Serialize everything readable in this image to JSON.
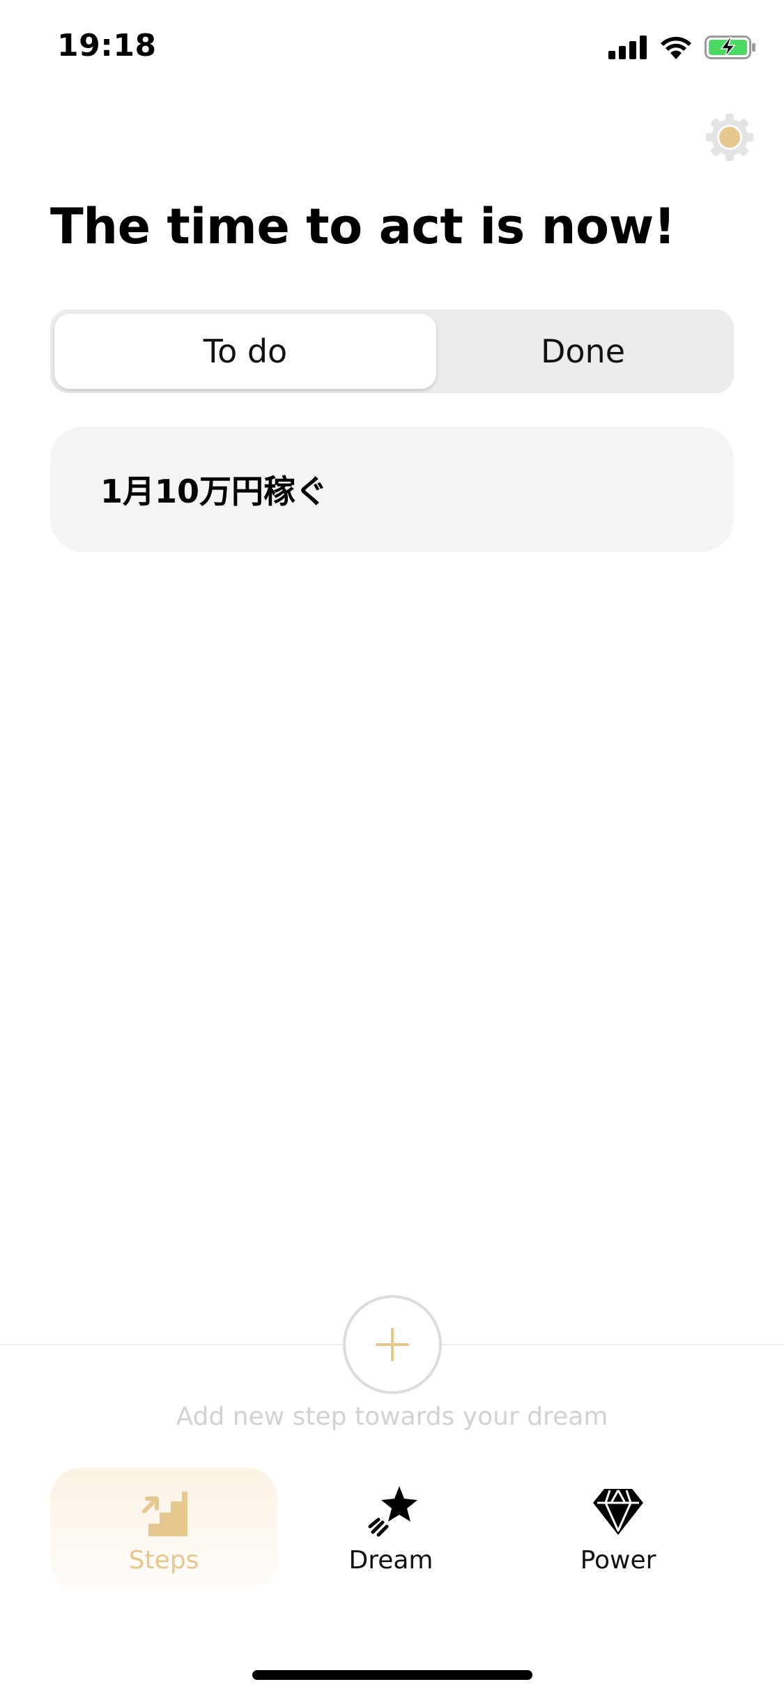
{
  "status_bar": {
    "time": "19:18",
    "icons": [
      "cellular-signal-icon",
      "wifi-icon",
      "battery-charging-icon"
    ]
  },
  "header": {
    "settings_icon": "gear-icon",
    "title": "The time to act is now!"
  },
  "segmented_control": {
    "options": [
      "To do",
      "Done"
    ],
    "selected": "To do"
  },
  "steps": [
    {
      "text": "1月10万円稼ぐ"
    }
  ],
  "add_step": {
    "icon": "plus-icon",
    "hint": "Add new step towards your dream"
  },
  "tab_bar": {
    "active": "Steps",
    "tabs": [
      {
        "label": "Steps",
        "icon": "stairs-icon"
      },
      {
        "label": "Dream",
        "icon": "shooting-star-icon"
      },
      {
        "label": "Power",
        "icon": "diamond-icon"
      }
    ]
  },
  "colors": {
    "accent": "#e6c78e",
    "segment_bg": "#ececec",
    "card_bg": "#f4f4f4",
    "hint_text": "#d2d2d2"
  }
}
